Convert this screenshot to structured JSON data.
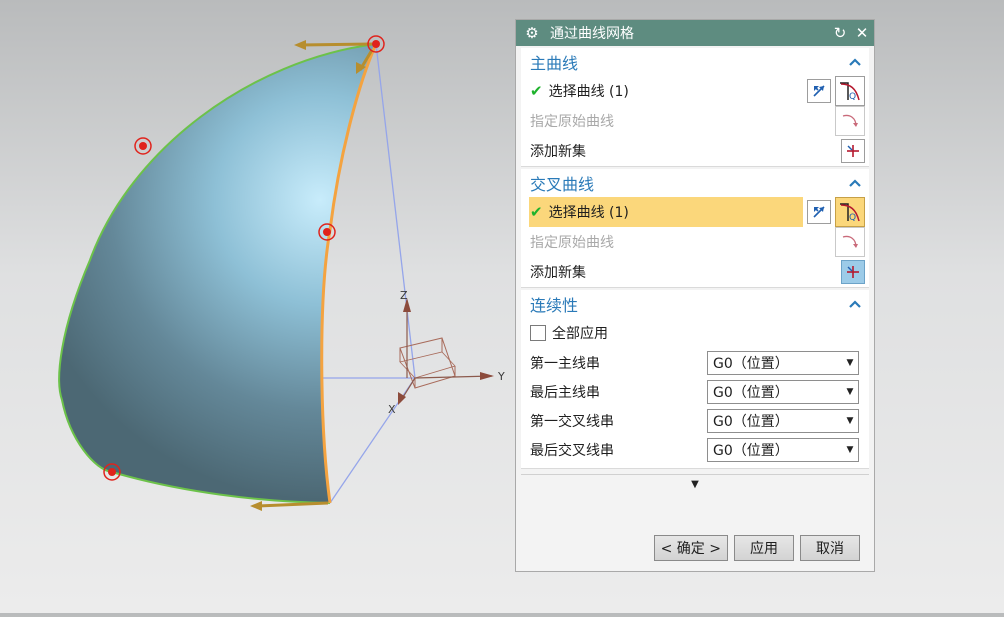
{
  "dialog": {
    "title": "通过曲线网格",
    "icons": {
      "settings": "gear-icon",
      "reset": "reset-icon",
      "close": "close-icon"
    }
  },
  "primary": {
    "heading": "主曲线",
    "select_label": "选择曲线 (1)",
    "specify_label": "指定原始曲线",
    "add_label": "添加新集"
  },
  "cross": {
    "heading": "交叉曲线",
    "select_label": "选择曲线 (1)",
    "specify_label": "指定原始曲线",
    "add_label": "添加新集"
  },
  "continuity": {
    "heading": "连续性",
    "apply_all_label": "全部应用",
    "rows": [
      {
        "label": "第一主线串",
        "value": "G0（位置）"
      },
      {
        "label": "最后主线串",
        "value": "G0（位置）"
      },
      {
        "label": "第一交叉线串",
        "value": "G0（位置）"
      },
      {
        "label": "最后交叉线串",
        "value": "G0（位置）"
      }
    ]
  },
  "footer": {
    "ok_label": "< 确定 >",
    "apply_label": "应用",
    "cancel_label": "取消"
  },
  "viewport": {
    "axes": {
      "z": "Z",
      "y": "Y",
      "x": "X"
    },
    "colors": {
      "surface_light": "#b6e0f2",
      "surface_dark": "#4f6c79",
      "edge_green": "#6cc24a",
      "edge_orange": "#f4a340",
      "point_red": "#e0231c",
      "axis_blue": "#8f9ee6"
    }
  }
}
